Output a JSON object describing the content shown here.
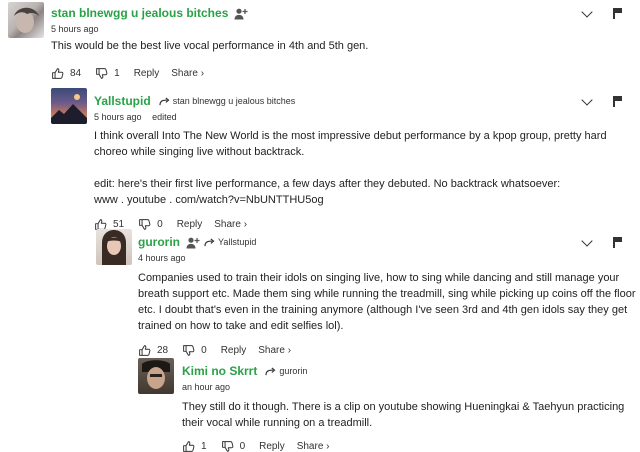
{
  "comments": [
    {
      "username": "stan blnewgg u jealous bitches",
      "time": "5 hours ago",
      "text": [
        "This would be the best live vocal performance in 4th and 5th gen."
      ],
      "likes": "84",
      "dislikes": "1",
      "reply_label": "Reply",
      "share_label": "Share ›"
    },
    {
      "username": "Yallstupid",
      "reply_to": "stan blnewgg u jealous bitches",
      "time": "5 hours ago",
      "edited": "edited",
      "text": [
        "I think overall Into The New World is the most impressive debut performance by a kpop group, pretty hard choreo while singing live without backtrack.",
        "edit: here's their first live performance, a few days after they debuted. No backtrack whatsoever:\nwww . youtube . com/watch?v=NbUNTTHU5og"
      ],
      "likes": "51",
      "dislikes": "0",
      "reply_label": "Reply",
      "share_label": "Share ›"
    },
    {
      "username": "gurorin",
      "reply_to": "Yallstupid",
      "time": "4 hours ago",
      "text": [
        "Companies used to train their idols on singing live, how to sing while dancing and still manage your breath support etc. Made them sing while running the treadmill, sing while picking up coins off the floor etc. I doubt that's even in the training anymore (although I've seen 3rd and 4th gen idols say they get trained on how to take and edit selfies lol)."
      ],
      "likes": "28",
      "dislikes": "0",
      "reply_label": "Reply",
      "share_label": "Share ›"
    },
    {
      "username": "Kimi no Skrrt",
      "reply_to": "gurorin",
      "time": "an hour ago",
      "text": [
        "They still do it though. There is a clip on youtube showing Hueningkai & Taehyun practicing their vocal while running on a treadmill."
      ],
      "likes": "1",
      "dislikes": "0",
      "reply_label": "Reply",
      "share_label": "Share ›"
    }
  ],
  "colors": {
    "username": "#2aa148",
    "text": "#222222",
    "meta": "#333333"
  },
  "icons": [
    "follow-user-icon",
    "reply-arrow-icon",
    "thumbs-up-icon",
    "thumbs-down-icon",
    "collapse-chevron-icon",
    "report-flag-icon"
  ]
}
